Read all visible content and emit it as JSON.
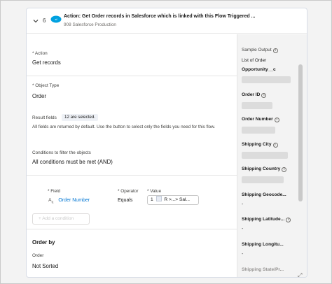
{
  "step": {
    "number": "6",
    "title": "Action: Get Order records in Salesforce which is linked with this Flow Triggered ...",
    "subtitle": "908 Salesforce Production"
  },
  "action": {
    "label": "* Action",
    "value": "Get records"
  },
  "object_type": {
    "label": "* Object Type",
    "value": "Order"
  },
  "result_fields": {
    "label": "Result fields",
    "badge": "12 are selected.",
    "help": "All fields are returned by default. Use the button to select only the fields you need for this flow."
  },
  "conditions": {
    "label": "Conditions to filter the objects",
    "value": "All conditions must be met (AND)",
    "field_label": "* Field",
    "operator_label": "* Operator",
    "value_label": "* Value",
    "field_value": "Order Number",
    "operator_value": "Equals",
    "value_number": "1",
    "value_text": "R >...> Sal...",
    "add_button": "+ Add a condition"
  },
  "order_by": {
    "title": "Order by",
    "label": "Order",
    "value": "Not Sorted"
  },
  "sample_output": {
    "title": "Sample Output",
    "list_title": "List of Order",
    "fields": [
      {
        "name": "Opportunity__c"
      },
      {
        "name": "Order ID"
      },
      {
        "name": "Order Number"
      },
      {
        "name": "Shipping City"
      },
      {
        "name": "Shipping Country"
      },
      {
        "name": "Shipping Geocode..."
      },
      {
        "name": "Shipping Latitude..."
      },
      {
        "name": "Shipping Longitu..."
      },
      {
        "name": "Shipping State/Pr..."
      }
    ],
    "dash": "-"
  },
  "icons": {
    "chevron": "chevron-down-icon",
    "salesforce": "salesforce-cloud-icon",
    "info": "info-icon",
    "expand": "expand-icon"
  },
  "colors": {
    "link": "#0176d3",
    "salesforce": "#00a1e0"
  }
}
